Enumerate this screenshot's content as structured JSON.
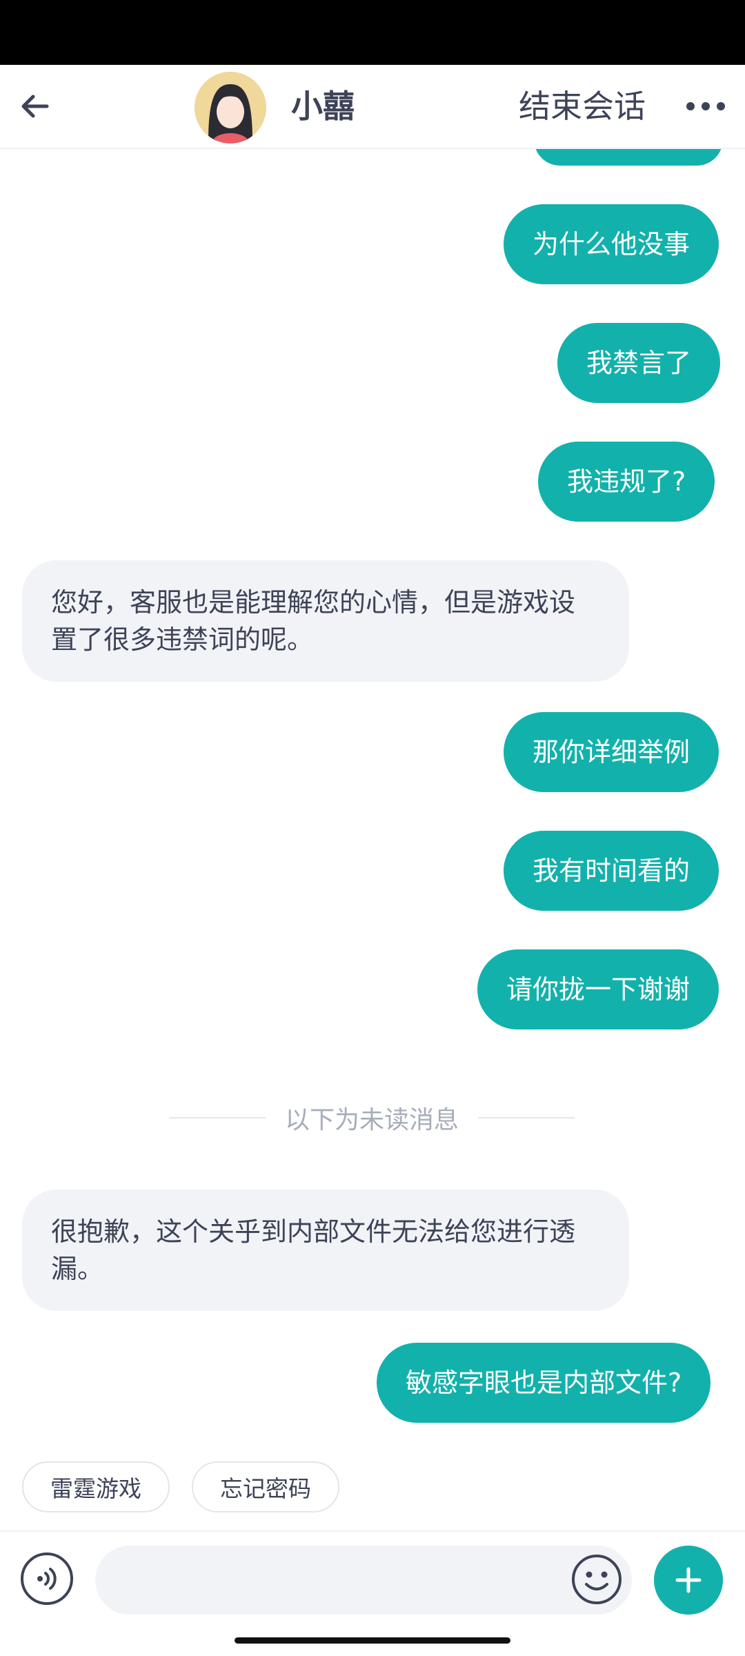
{
  "header": {
    "contact_name": "小囍",
    "end_session_label": "结束会话"
  },
  "messages": {
    "m1": "为什么他没事",
    "m2": "我禁言了",
    "m3": "我违规了?",
    "m4": "您好，客服也是能理解您的心情，但是游戏设置了很多违禁词的呢。",
    "m5": "那你详细举例",
    "m6": "我有时间看的",
    "m7": "请你拢一下谢谢",
    "m8": "很抱歉，这个关乎到内部文件无法给您进行透漏。",
    "m9": "敏感字眼也是内部文件?"
  },
  "divider_text": "以下为未读消息",
  "quick_replies": [
    "雷霆游戏",
    "忘记密码"
  ],
  "colors": {
    "accent": "#13b1ab",
    "incoming_bubble": "#f1f3f7",
    "text": "#3d4357"
  },
  "icons": [
    "back-arrow-icon",
    "more-icon",
    "voice-icon",
    "emoji-icon",
    "plus-icon"
  ]
}
